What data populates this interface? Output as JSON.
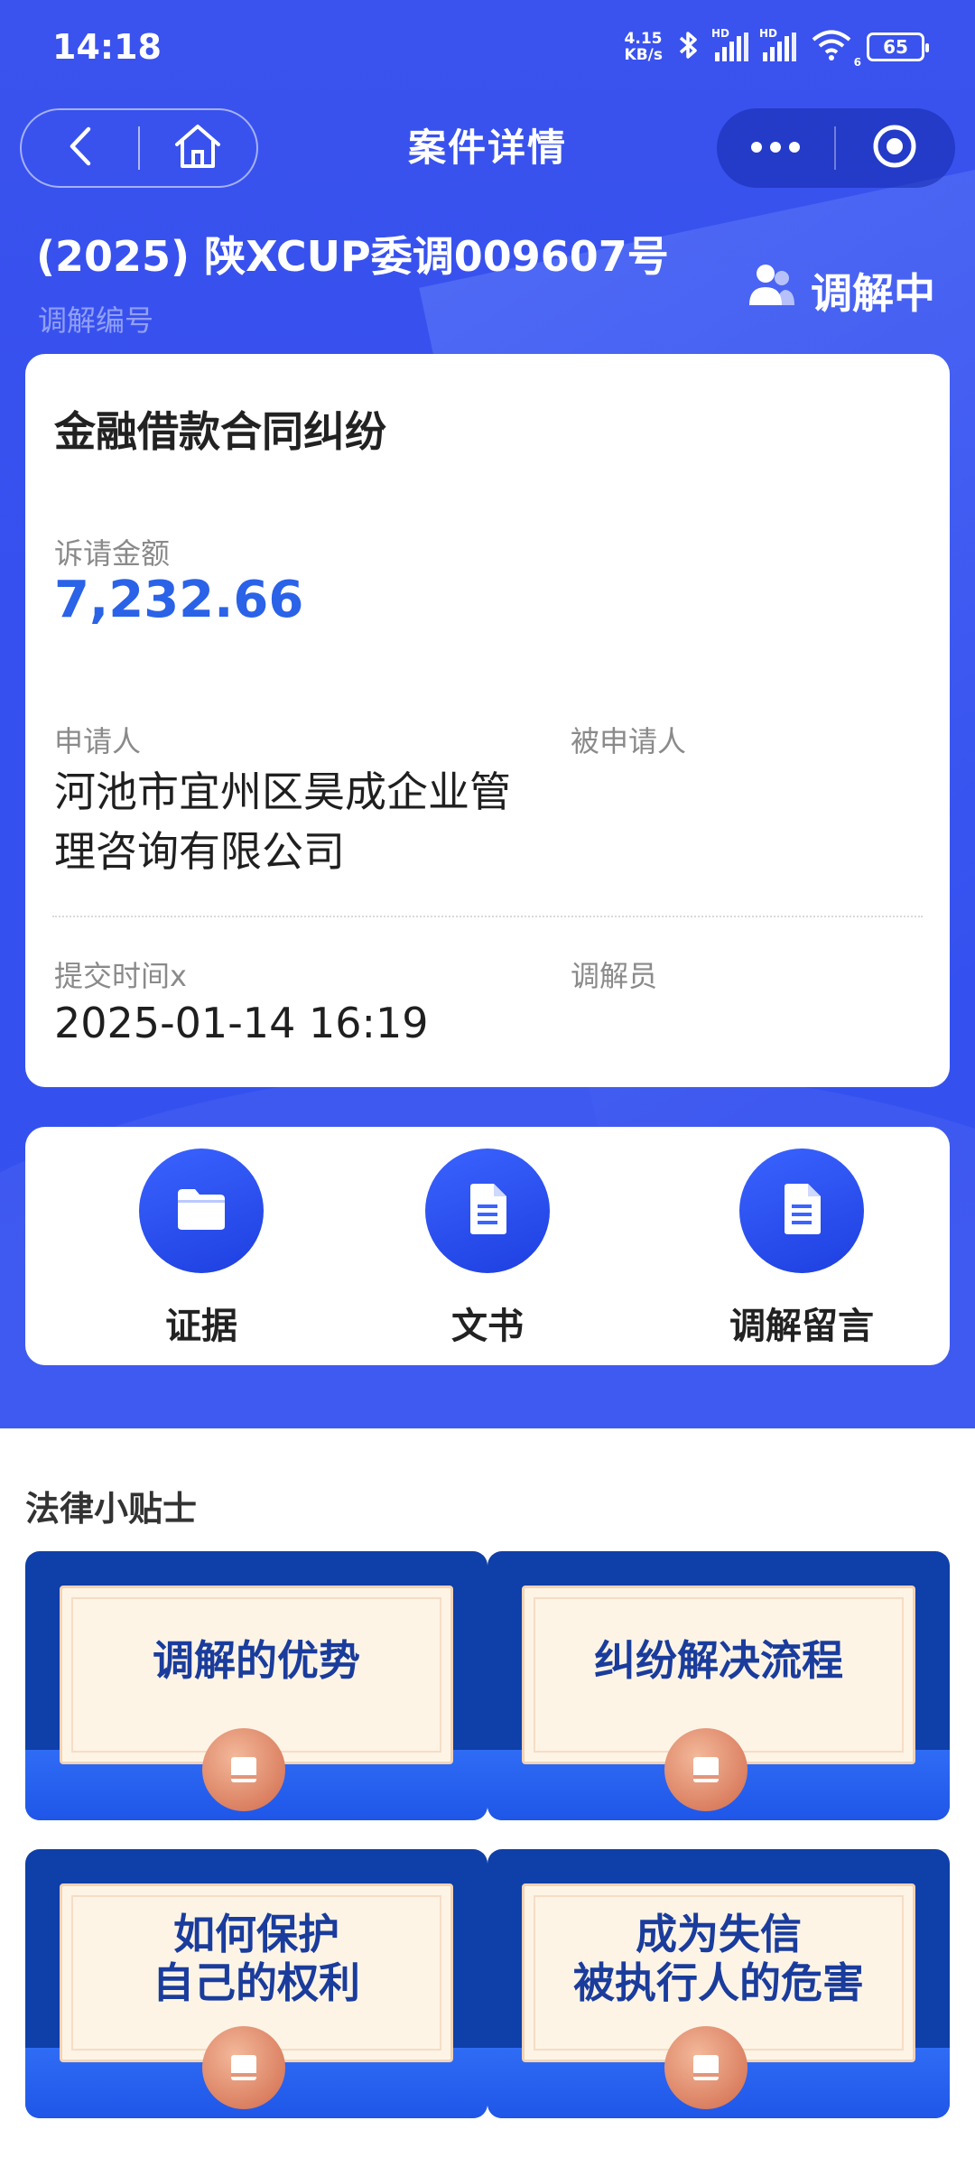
{
  "status_bar": {
    "time": "14:18",
    "net_speed_value": "4.15",
    "net_speed_unit": "KB/s",
    "hd1": "HD",
    "hd2": "HD",
    "battery": "65",
    "wifi_index": "6"
  },
  "nav": {
    "title": "案件详情",
    "icons": [
      "back-icon",
      "home-icon",
      "more-icon",
      "target-icon"
    ]
  },
  "case": {
    "number": "(2025) 陕XCUP委调009607号",
    "number_label": "调解编号",
    "status": "调解中",
    "type": "金融借款合同纠纷",
    "amount_label": "诉请金额",
    "amount": "7,232.66",
    "applicant_label": "申请人",
    "applicant": "河池市宜州区昊成企业管理咨询有限公司",
    "respondent_label": "被申请人",
    "respondent": "",
    "submit_time_label": "提交时间x",
    "submit_time": "2025-01-14 16:19",
    "mediator_label": "调解员",
    "mediator": ""
  },
  "actions": [
    {
      "label": "证据",
      "icon": "folder-icon"
    },
    {
      "label": "文书",
      "icon": "document-icon"
    },
    {
      "label": "调解留言",
      "icon": "document-icon"
    }
  ],
  "tips": {
    "title": "法律小贴士",
    "cards": [
      {
        "line1": "调解的优势",
        "line2": ""
      },
      {
        "line1": "纠纷解决流程",
        "line2": ""
      },
      {
        "line1": "如何保护",
        "line2": "自己的权利"
      },
      {
        "line1": "成为失信",
        "line2": "被执行人的危害"
      }
    ]
  },
  "colors": {
    "header_blue": "#3450ef",
    "amount_blue": "#2a62e8",
    "tip_title_blue": "#1a3c9c"
  }
}
